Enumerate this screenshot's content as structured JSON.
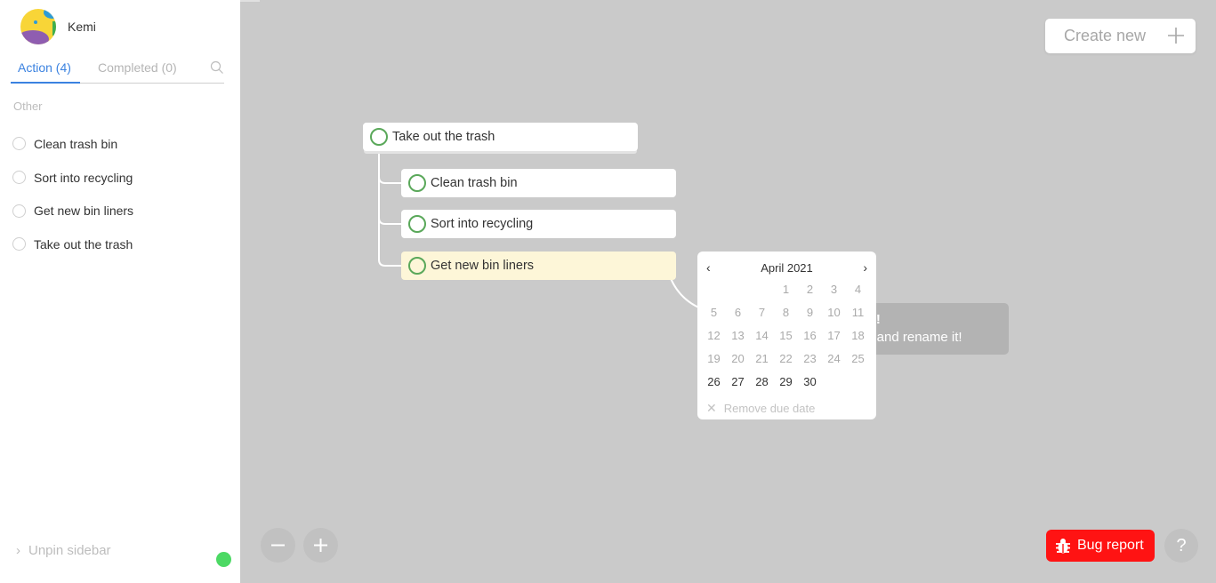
{
  "user": {
    "name": "Kemi",
    "avatar_colors": [
      "#f8d537",
      "#8f5db0",
      "#2e9bd6",
      "#3fae4f"
    ]
  },
  "sidebar": {
    "tabs": [
      {
        "label": "Action (4)",
        "active": true
      },
      {
        "label": "Completed (0)",
        "active": false
      }
    ],
    "group_label": "Other",
    "tasks": [
      {
        "label": "Clean trash bin"
      },
      {
        "label": "Sort into recycling"
      },
      {
        "label": "Get new bin liners"
      },
      {
        "label": "Take out the trash"
      }
    ],
    "unpin_label": "Unpin sidebar",
    "status": "online"
  },
  "toolbar": {
    "create_new_label": "Create new"
  },
  "tree": {
    "root": {
      "label": "Take out the trash"
    },
    "children": [
      {
        "label": "Clean trash bin"
      },
      {
        "label": "Sort into recycling"
      },
      {
        "label": "Get new bin liners",
        "highlighted": true
      }
    ]
  },
  "hint": {
    "title": "ated!",
    "body": "task and rename it!"
  },
  "calendar": {
    "prev_icon": "‹",
    "next_icon": "›",
    "title": "April 2021",
    "leading_blanks": 3,
    "days": [
      "1",
      "2",
      "3",
      "4",
      "5",
      "6",
      "7",
      "8",
      "9",
      "10",
      "11",
      "12",
      "13",
      "14",
      "15",
      "16",
      "17",
      "18",
      "19",
      "20",
      "21",
      "22",
      "23",
      "24",
      "25",
      "26",
      "27",
      "28",
      "29",
      "30"
    ],
    "active_from": 26,
    "remove_label": "Remove due date"
  },
  "zoom": {
    "out_icon": "minus",
    "in_icon": "plus"
  },
  "footer": {
    "bug_report_label": "Bug report",
    "help_label": "?"
  },
  "colors": {
    "accent": "#3b82e0",
    "check": "#5aa85a",
    "bug": "#ff1313",
    "online": "#4cd964",
    "highlight": "#fdf6d8"
  }
}
